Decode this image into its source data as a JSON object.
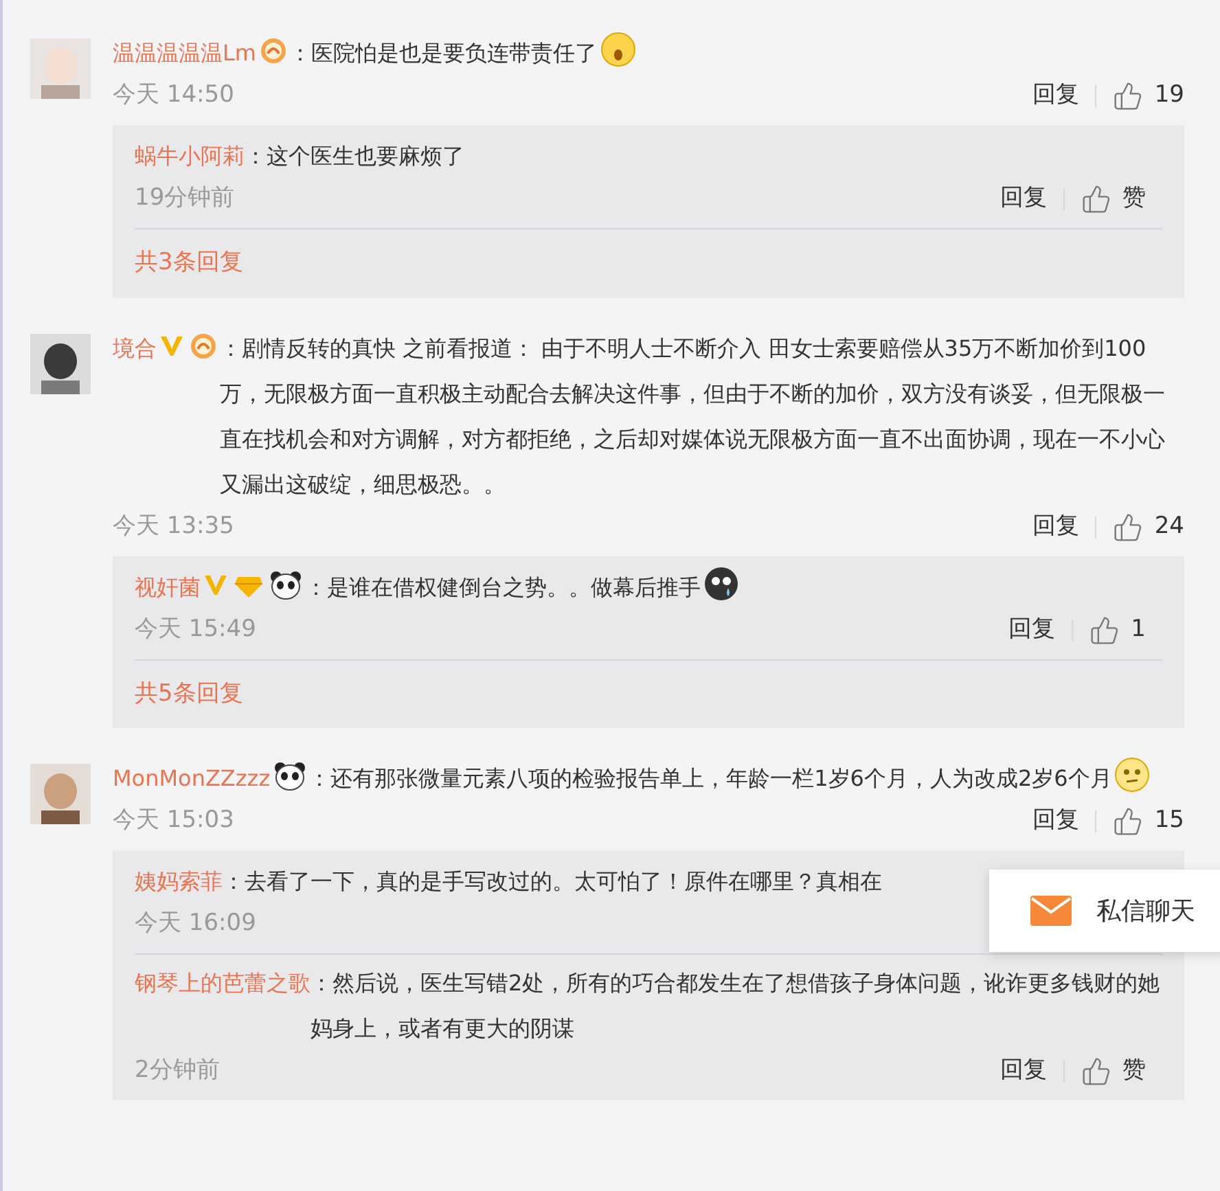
{
  "comments": [
    {
      "avatar": {
        "kind": "picture"
      },
      "user": "温温温温温Lm",
      "badges": [
        {
          "kind": "medal"
        }
      ],
      "separator": "：",
      "text": "医院怕是也是要负连带责任了",
      "emoji": {
        "kind": "shock"
      },
      "time": "今天 14:50",
      "reply_label": "回复",
      "likes": "19",
      "replies": [
        {
          "user": "蜗牛小阿莉",
          "separator": "：",
          "text": "这个医生也要麻烦了",
          "time": "19分钟前",
          "reply_label": "回复",
          "likes": "赞"
        }
      ],
      "more": "共3条回复"
    },
    {
      "avatar": {
        "kind": "picture"
      },
      "user": "境合",
      "badges": [
        {
          "kind": "verified"
        },
        {
          "kind": "medal"
        }
      ],
      "separator": "：",
      "text": "剧情反转的真快 之前看报道： 由于不明人士不断介入 田女士索要赔偿从35万不断加价到100万，无限极方面一直积极主动配合去解决这件事，但由于不断的加价，双方没有谈妥，但无限极一直在找机会和对方调解，对方都拒绝，之后却对媒体说无限极方面一直不出面协调，现在一不小心又漏出这破绽，细思极恐。。",
      "time": "今天 13:35",
      "reply_label": "回复",
      "likes": "24",
      "replies": [
        {
          "user": "视奸菌",
          "badges": [
            {
              "kind": "verified"
            },
            {
              "kind": "gem"
            },
            {
              "kind": "panda"
            }
          ],
          "separator": "：",
          "text": "是谁在借权健倒台之势。。做幕后推手",
          "emoji": {
            "kind": "tear"
          },
          "time": "今天 15:49",
          "reply_label": "回复",
          "likes": "1"
        }
      ],
      "more": "共5条回复"
    },
    {
      "avatar": {
        "kind": "picture"
      },
      "user": "MonMonZZzzz",
      "badges": [
        {
          "kind": "panda"
        }
      ],
      "separator": "：",
      "text": "还有那张微量元素八项的检验报告单上，年龄一栏1岁6个月，人为改成2岁6个月",
      "emoji": {
        "kind": "think"
      },
      "time": "今天 15:03",
      "reply_label": "回复",
      "likes": "15",
      "replies": [
        {
          "user": "姨妈索菲",
          "separator": "：",
          "text": "去看了一下，真的是手写改过的。太可怕了！原件在哪里？真相在",
          "time": "今天 16:09"
        },
        {
          "user": "钢琴上的芭蕾之歌",
          "separator": "：",
          "text": "然后说，医生写错2处，所有的巧合都发生在了想借孩子身体问题，讹诈更多钱财的她妈身上，或者有更大的阴谋",
          "time": "2分钟前",
          "reply_label": "回复",
          "likes": "赞"
        }
      ]
    }
  ],
  "popup": {
    "label": "私信聊天"
  }
}
